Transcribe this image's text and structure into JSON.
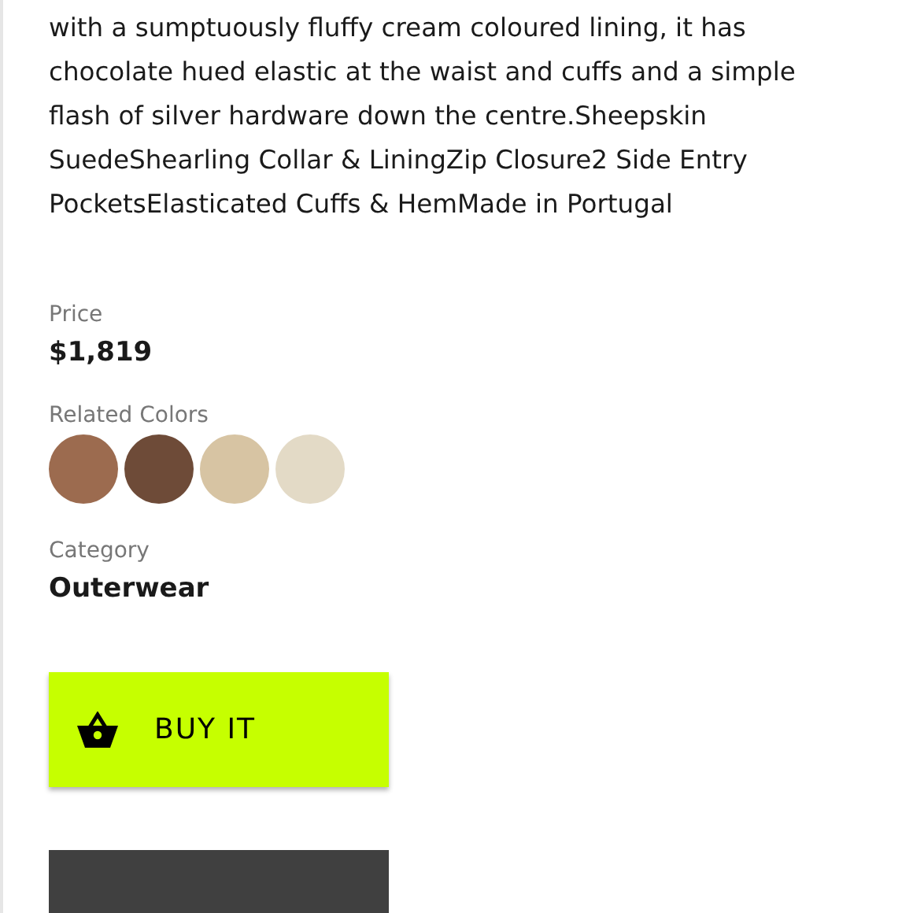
{
  "description": "with a sumptuously fluffy cream coloured lining, it has chocolate hued elastic at the waist and cuffs and a simple flash of silver hardware down the centre.Sheepskin SuedeShearling Collar & LiningZip Closure2 Side Entry PocketsElasticated Cuffs & HemMade in Portugal",
  "price": {
    "label": "Price",
    "value": "$1,819"
  },
  "related_colors": {
    "label": "Related Colors",
    "swatches": [
      {
        "color": "#9c6b4f"
      },
      {
        "color": "#6e4b38"
      },
      {
        "color": "#d7c4a3"
      },
      {
        "color": "#e3dac6"
      }
    ]
  },
  "category": {
    "label": "Category",
    "value": "Outerwear"
  },
  "buttons": [
    {
      "kind": "buy",
      "label": "BUY IT"
    },
    {
      "kind": "secondary"
    }
  ]
}
